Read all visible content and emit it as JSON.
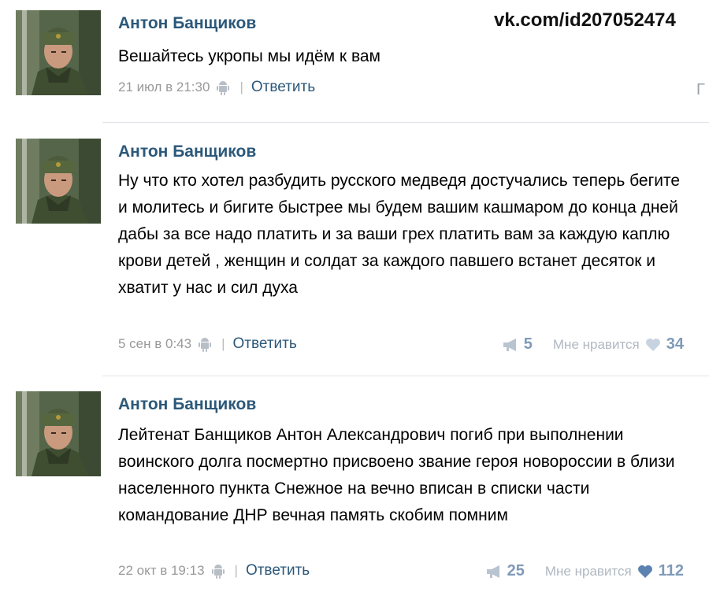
{
  "watermark": "vk.com/id207052474",
  "cut_off_char": "Г",
  "posts": [
    {
      "author": "Антон Банщиков",
      "text": "Вешайтесь укропы мы идём к вам",
      "date": "21 июл в 21:30",
      "reply_label": "Ответить"
    },
    {
      "author": "Антон Банщиков",
      "text": "Ну что кто хотел разбудить русского медведя достучались теперь бегите и молитесь и бигите быстрее мы будем вашим кашмаром до конца дней дабы за все надо платить и за ваши грех платить вам за каждую каплю крови детей , женщин и солдат за каждого павшего встанет десяток и хватит у нас и сил духа",
      "date": "5 сен в 0:43",
      "reply_label": "Ответить",
      "shares": "5",
      "like_label": "Мне нравится",
      "likes": "34"
    },
    {
      "author": "Антон Банщиков",
      "text": "Лейтенат Банщиков Антон Александрович погиб при выполнении воинского долга посмертно присвоено звание героя новороссии в близи населенного пункта Снежное на вечно вписан в списки части командование ДНР вечная память скобим помним",
      "date": "22 окт в 19:13",
      "reply_label": "Ответить",
      "shares": "25",
      "like_label": "Мне нравится",
      "likes": "112"
    }
  ],
  "icons": {
    "android": "android-icon",
    "share": "megaphone-icon",
    "like": "heart-icon"
  },
  "colors": {
    "author": "#2b587a",
    "link": "#2b587a",
    "meta": "#999999",
    "counter": "#7f9ab8"
  }
}
